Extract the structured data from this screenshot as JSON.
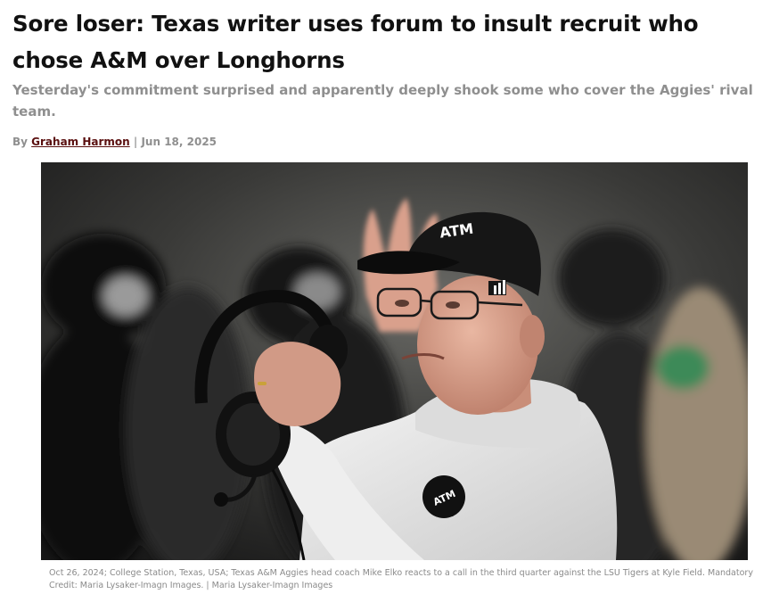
{
  "article": {
    "headline": "Sore loser: Texas writer uses forum to insult recruit who chose A&M over Longhorns",
    "subheadline": "Yesterday's commitment surprised and apparently deeply shook some who cover the Aggies' rival team.",
    "byline_prefix": "By",
    "author": "Graham Harmon",
    "separator": "|",
    "date": "Jun 18, 2025"
  },
  "photo": {
    "cap_logo_text": "ATM",
    "caption": "Oct 26, 2024; College Station, Texas, USA; Texas A&M Aggies head coach Mike Elko reacts to a call in the third quarter against the LSU Tigers at Kyle Field. Mandatory Credit: Maria Lysaker-Imagn Images. | Maria Lysaker-Imagn Images"
  },
  "colors": {
    "headline": "#111111",
    "muted": "#8f8f8f",
    "author_link": "#5a0f0f"
  }
}
